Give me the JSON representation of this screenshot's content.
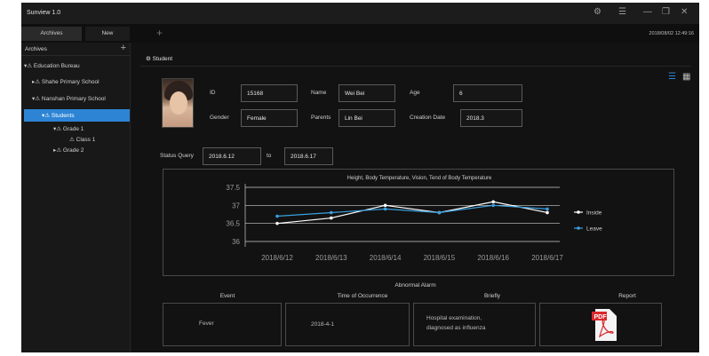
{
  "app": {
    "title": "Sunview 1.0"
  },
  "tabs": [
    {
      "label": "Archives"
    },
    {
      "label": "New"
    }
  ],
  "clock": "2018/08/02 12:49:16",
  "sidebar": {
    "header": "Archives",
    "tree": [
      {
        "label": "Education Bureau"
      },
      {
        "label": "Shahe Primary School"
      },
      {
        "label": "Nanshan Primary School"
      },
      {
        "label": "Students"
      },
      {
        "label": "Grade 1"
      },
      {
        "label": "Class 1"
      },
      {
        "label": "Grade 2"
      }
    ]
  },
  "breadcrumb": "Student",
  "profile": {
    "id_label": "ID",
    "id": "15168",
    "name_label": "Name",
    "name": "Wei Bei",
    "age_label": "Age",
    "age": "6",
    "gender_label": "Gender",
    "gender": "Female",
    "parents_label": "Parents",
    "parents": "Lin Bei",
    "creation_label": "Creation Date",
    "creation": "2018.3"
  },
  "status_query": {
    "label": "Status Query",
    "from": "2018.6.12",
    "to_label": "to",
    "to": "2018.6.17"
  },
  "chart_data": {
    "type": "line",
    "title": "Height, Body Temperature, Vision, Tend of Body Temperature",
    "categories": [
      "2018/6/12",
      "2018/6/13",
      "2018/6/14",
      "2018/6/15",
      "2018/6/16",
      "2018/6/17"
    ],
    "y_ticks": [
      "37.5",
      "37",
      "36.5",
      "36"
    ],
    "ylim": [
      36,
      37.5
    ],
    "series": [
      {
        "name": "Inside",
        "color": "#ffffff",
        "values": [
          36.5,
          36.65,
          37.0,
          36.8,
          37.1,
          36.8
        ]
      },
      {
        "name": "Leave",
        "color": "#3aa0e0",
        "values": [
          36.7,
          36.8,
          36.9,
          36.8,
          37.0,
          36.9
        ]
      }
    ],
    "legend": "right",
    "grid": true
  },
  "alarm": {
    "title": "Abnormal Alarm",
    "columns": [
      "Event",
      "Time of Occurrence",
      "Briefly",
      "Report"
    ],
    "row": {
      "event": "Fever",
      "time": "2018-4-1",
      "brief_line1": "Hospital examination,",
      "brief_line2": "diagnosed as influenza",
      "report_icon": "pdf-icon",
      "report_label": "PDF"
    }
  },
  "colors": {
    "accent": "#2d84d4",
    "series_inside": "#ffffff",
    "series_leave": "#3aa0e0"
  }
}
